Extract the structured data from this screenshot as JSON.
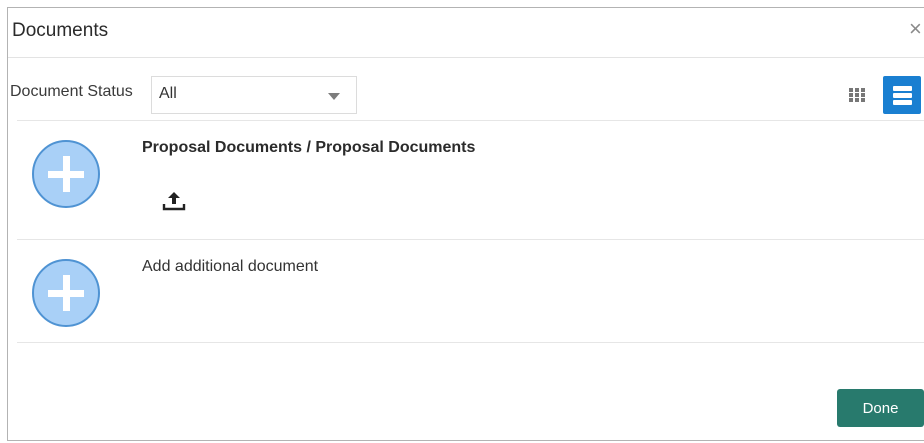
{
  "dialog": {
    "title": "Documents",
    "close_glyph": "×"
  },
  "filter": {
    "label": "Document Status",
    "selected": "All"
  },
  "view_toggle": {
    "grid_icon": "grid-icon",
    "list_icon": "list-icon",
    "active": "list",
    "active_color": "#1a7fd1"
  },
  "documents": [
    {
      "title": "Proposal Documents / Proposal Documents",
      "action_icon": "upload-icon"
    }
  ],
  "add_document": {
    "label": "Add additional document"
  },
  "footer": {
    "done_label": "Done",
    "done_color": "#287a6d"
  },
  "colors": {
    "plus_fill": "#a9d0f7",
    "plus_border": "#4f93d3"
  }
}
